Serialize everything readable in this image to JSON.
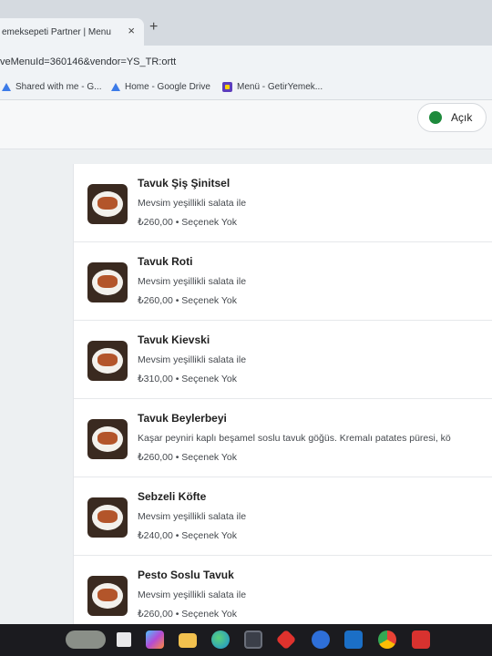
{
  "browser": {
    "tab_title": "emeksepeti Partner | Menu",
    "tab_close": "×",
    "new_tab": "+",
    "url": "veMenuId=360146&vendor=YS_TR:ortt",
    "bookmarks": [
      {
        "label": "Shared with me - G...",
        "icon": "drive-icon"
      },
      {
        "label": "Home - Google Drive",
        "icon": "drive-icon"
      },
      {
        "label": "Menü - GetirYemek...",
        "icon": "getir-icon"
      }
    ]
  },
  "header": {
    "status_label": "Açık",
    "status_color": "#1e8a3c"
  },
  "menu_items": [
    {
      "name": "Tavuk Şiş Şinitsel",
      "description": "Mevsim yeşillikli salata ile",
      "price": "₺260,00 • Seçenek Yok"
    },
    {
      "name": "Tavuk Roti",
      "description": "Mevsim yeşillikli salata ile",
      "price": "₺260,00 • Seçenek Yok"
    },
    {
      "name": "Tavuk Kievski",
      "description": "Mevsim yeşillikli salata ile",
      "price": "₺310,00 • Seçenek Yok"
    },
    {
      "name": "Tavuk Beylerbeyi",
      "description": "Kaşar peyniri kaplı beşamel soslu tavuk göğüs. Kremalı patates püresi, kö",
      "price": "₺260,00 • Seçenek Yok"
    },
    {
      "name": "Sebzeli Köfte",
      "description": "Mevsim yeşillikli salata ile",
      "price": "₺240,00 • Seçenek Yok"
    },
    {
      "name": "Pesto Soslu Tavuk",
      "description": "Mevsim yeşillikli salata ile",
      "price": "₺260,00 • Seçenek Yok"
    }
  ],
  "taskbar_icons": [
    "weather-icon",
    "task-view-icon",
    "copilot-icon",
    "file-explorer-icon",
    "edge-icon",
    "store-icon",
    "app-icon",
    "app-icon",
    "outlook-icon",
    "chrome-icon",
    "app-icon"
  ]
}
